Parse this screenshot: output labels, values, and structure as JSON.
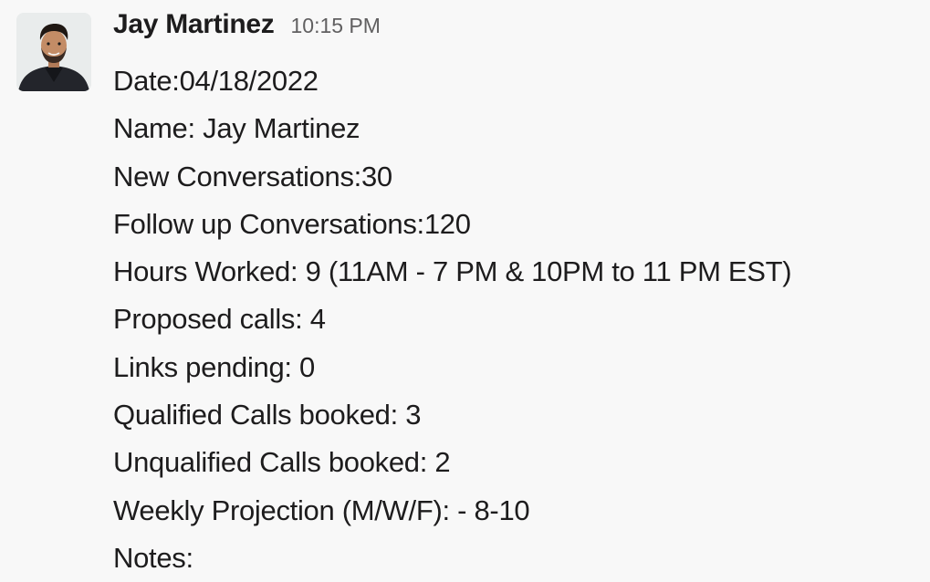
{
  "message": {
    "author": "Jay Martinez",
    "timestamp": "10:15 PM",
    "lines": [
      "Date:04/18/2022",
      "Name: Jay Martinez",
      "New Conversations:30",
      "Follow up Conversations:120",
      "Hours Worked: 9 (11AM - 7 PM & 10PM to 11 PM EST)",
      "Proposed calls: 4",
      "Links pending: 0",
      "Qualified Calls booked: 3",
      "Unqualified Calls booked: 2",
      "Weekly Projection (M/W/F): - 8-10",
      "Notes:"
    ]
  },
  "colors": {
    "background": "#f8f8f8",
    "text": "#1d1c1d",
    "timestamp": "#616061"
  }
}
